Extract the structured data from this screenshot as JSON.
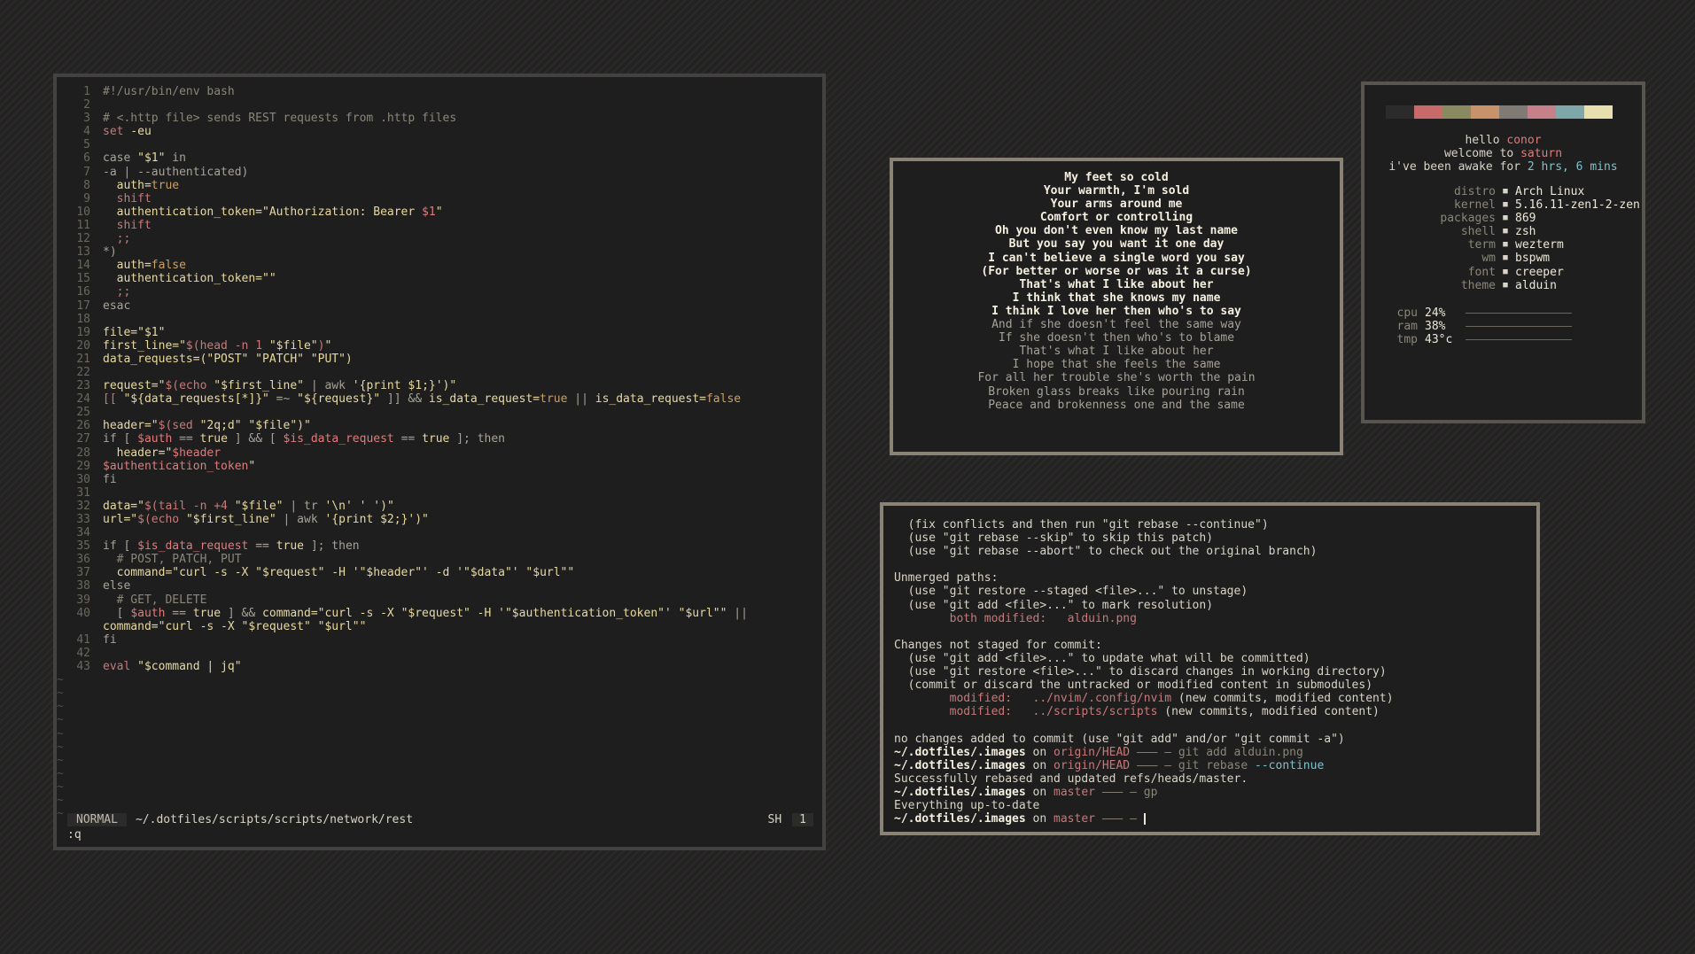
{
  "editor": {
    "lines": [
      {
        "n": "1",
        "segs": [
          {
            "t": "#!/usr/bin/env bash",
            "c": "c-com"
          }
        ]
      },
      {
        "n": "2",
        "segs": []
      },
      {
        "n": "3",
        "segs": [
          {
            "t": "# <.http file> sends REST requests from .http files",
            "c": "c-com"
          }
        ]
      },
      {
        "n": "4",
        "segs": [
          {
            "t": "set",
            "c": "c-fn"
          },
          {
            "t": " -eu",
            "c": "c-str"
          }
        ]
      },
      {
        "n": "5",
        "segs": []
      },
      {
        "n": "6",
        "segs": [
          {
            "t": "case ",
            "c": "c-kw"
          },
          {
            "t": "\"$1\"",
            "c": "c-str"
          },
          {
            "t": " in",
            "c": "c-kw"
          }
        ]
      },
      {
        "n": "7",
        "segs": [
          {
            "t": "-a | --authenticated)",
            "c": "c-kw"
          }
        ]
      },
      {
        "n": "8",
        "segs": [
          {
            "t": "  auth=",
            "c": "c-str"
          },
          {
            "t": "true",
            "c": "c-bool"
          }
        ]
      },
      {
        "n": "9",
        "segs": [
          {
            "t": "  shift",
            "c": "c-fn"
          }
        ]
      },
      {
        "n": "10",
        "segs": [
          {
            "t": "  authentication_token=\"Authorization: Bearer ",
            "c": "c-str"
          },
          {
            "t": "$1",
            "c": "c-var"
          },
          {
            "t": "\"",
            "c": "c-str"
          }
        ]
      },
      {
        "n": "11",
        "segs": [
          {
            "t": "  shift",
            "c": "c-fn"
          }
        ]
      },
      {
        "n": "12",
        "segs": [
          {
            "t": "  ;;",
            "c": "c-fn"
          }
        ]
      },
      {
        "n": "13",
        "segs": [
          {
            "t": "*)",
            "c": "c-kw"
          }
        ]
      },
      {
        "n": "14",
        "segs": [
          {
            "t": "  auth=",
            "c": "c-str"
          },
          {
            "t": "false",
            "c": "c-bool"
          }
        ]
      },
      {
        "n": "15",
        "segs": [
          {
            "t": "  authentication_token=\"\"",
            "c": "c-str"
          }
        ]
      },
      {
        "n": "16",
        "segs": [
          {
            "t": "  ;;",
            "c": "c-fn"
          }
        ]
      },
      {
        "n": "17",
        "segs": [
          {
            "t": "esac",
            "c": "c-kw"
          }
        ]
      },
      {
        "n": "18",
        "segs": []
      },
      {
        "n": "19",
        "segs": [
          {
            "t": "file=\"$1\"",
            "c": "c-str"
          }
        ]
      },
      {
        "n": "20",
        "segs": [
          {
            "t": "first_line=\"",
            "c": "c-str"
          },
          {
            "t": "$(head -n 1 ",
            "c": "c-fn"
          },
          {
            "t": "\"$file\"",
            "c": "c-str"
          },
          {
            "t": ")",
            "c": "c-fn"
          },
          {
            "t": "\"",
            "c": "c-str"
          }
        ]
      },
      {
        "n": "21",
        "segs": [
          {
            "t": "data_requests=(\"POST\" \"PATCH\" \"PUT\")",
            "c": "c-str"
          }
        ]
      },
      {
        "n": "22",
        "segs": []
      },
      {
        "n": "23",
        "segs": [
          {
            "t": "request=\"",
            "c": "c-str"
          },
          {
            "t": "$(echo ",
            "c": "c-fn"
          },
          {
            "t": "\"$first_line\"",
            "c": "c-str"
          },
          {
            "t": " | awk ",
            "c": "c-kw"
          },
          {
            "t": "'{print $1;}'",
            "c": "c-str"
          },
          {
            "t": ")\"",
            "c": "c-str"
          }
        ]
      },
      {
        "n": "24",
        "segs": [
          {
            "t": "[[ ",
            "c": "c-fn"
          },
          {
            "t": "\"${data_requests[*]}\"",
            "c": "c-str"
          },
          {
            "t": " =~ ",
            "c": "c-kw"
          },
          {
            "t": "\"${request}\"",
            "c": "c-str"
          },
          {
            "t": " ]] && ",
            "c": "c-kw"
          },
          {
            "t": "is_data_request=",
            "c": "c-str"
          },
          {
            "t": "true",
            "c": "c-bool"
          },
          {
            "t": " || ",
            "c": "c-kw"
          },
          {
            "t": "is_data_request=",
            "c": "c-str"
          },
          {
            "t": "false",
            "c": "c-bool"
          }
        ]
      },
      {
        "n": "25",
        "segs": []
      },
      {
        "n": "26",
        "segs": [
          {
            "t": "header=\"",
            "c": "c-str"
          },
          {
            "t": "$(sed ",
            "c": "c-fn"
          },
          {
            "t": "\"2q;d\" \"$file\"",
            "c": "c-str"
          },
          {
            "t": ")\"",
            "c": "c-str"
          }
        ]
      },
      {
        "n": "27",
        "segs": [
          {
            "t": "if [ ",
            "c": "c-kw"
          },
          {
            "t": "$auth",
            "c": "c-var"
          },
          {
            "t": " == ",
            "c": "c-kw"
          },
          {
            "t": "true",
            "c": "c-str"
          },
          {
            "t": " ] && [ ",
            "c": "c-kw"
          },
          {
            "t": "$is_data_request",
            "c": "c-var"
          },
          {
            "t": " == ",
            "c": "c-kw"
          },
          {
            "t": "true",
            "c": "c-str"
          },
          {
            "t": " ]; then",
            "c": "c-kw"
          }
        ]
      },
      {
        "n": "28",
        "segs": [
          {
            "t": "  header=\"",
            "c": "c-str"
          },
          {
            "t": "$header",
            "c": "c-var"
          }
        ]
      },
      {
        "n": "29",
        "segs": [
          {
            "t": "$authentication_token",
            "c": "c-var"
          },
          {
            "t": "\"",
            "c": "c-str"
          }
        ]
      },
      {
        "n": "30",
        "segs": [
          {
            "t": "fi",
            "c": "c-kw"
          }
        ]
      },
      {
        "n": "31",
        "segs": []
      },
      {
        "n": "32",
        "segs": [
          {
            "t": "data=\"",
            "c": "c-str"
          },
          {
            "t": "$(tail -n +4 ",
            "c": "c-fn"
          },
          {
            "t": "\"$file\"",
            "c": "c-str"
          },
          {
            "t": " | tr ",
            "c": "c-kw"
          },
          {
            "t": "'\\n' ' ')",
            "c": "c-str"
          },
          {
            "t": "\"",
            "c": "c-str"
          }
        ]
      },
      {
        "n": "33",
        "segs": [
          {
            "t": "url=\"",
            "c": "c-str"
          },
          {
            "t": "$(echo ",
            "c": "c-fn"
          },
          {
            "t": "\"$first_line\"",
            "c": "c-str"
          },
          {
            "t": " | awk ",
            "c": "c-kw"
          },
          {
            "t": "'{print $2;}'",
            "c": "c-str"
          },
          {
            "t": ")\"",
            "c": "c-str"
          }
        ]
      },
      {
        "n": "34",
        "segs": []
      },
      {
        "n": "35",
        "segs": [
          {
            "t": "if [ ",
            "c": "c-kw"
          },
          {
            "t": "$is_data_request",
            "c": "c-var"
          },
          {
            "t": " == ",
            "c": "c-kw"
          },
          {
            "t": "true",
            "c": "c-str"
          },
          {
            "t": " ]; then",
            "c": "c-kw"
          }
        ]
      },
      {
        "n": "36",
        "segs": [
          {
            "t": "  # POST, PATCH, PUT",
            "c": "c-com"
          }
        ]
      },
      {
        "n": "37",
        "segs": [
          {
            "t": "  command=\"curl -s -X \"$request\" -H '\"$header\"' -d '\"$data\"' \"$url\"\"",
            "c": "c-str"
          }
        ]
      },
      {
        "n": "38",
        "segs": [
          {
            "t": "else",
            "c": "c-kw"
          }
        ]
      },
      {
        "n": "39",
        "segs": [
          {
            "t": "  # GET, DELETE",
            "c": "c-com"
          }
        ]
      },
      {
        "n": "40",
        "segs": [
          {
            "t": "  [ ",
            "c": "c-kw"
          },
          {
            "t": "$auth",
            "c": "c-var"
          },
          {
            "t": " == ",
            "c": "c-kw"
          },
          {
            "t": "true",
            "c": "c-str"
          },
          {
            "t": " ] && ",
            "c": "c-kw"
          },
          {
            "t": "command=\"curl -s -X \"$request\" -H '\"$authentication_token\"' \"$url\"\"",
            "c": "c-str"
          },
          {
            "t": " ||",
            "c": "c-kw"
          }
        ]
      },
      {
        "n": "",
        "segs": [
          {
            "t": "command=\"curl -s -X \"$request\" \"$url\"\"",
            "c": "c-str"
          }
        ]
      },
      {
        "n": "41",
        "segs": [
          {
            "t": "fi",
            "c": "c-kw"
          }
        ]
      },
      {
        "n": "42",
        "segs": []
      },
      {
        "n": "43",
        "segs": [
          {
            "t": "eval",
            "c": "c-fn"
          },
          {
            "t": " \"$command | jq\"",
            "c": "c-str"
          }
        ]
      }
    ],
    "tilde_count": 11,
    "tilde": "~",
    "status": {
      "mode": "NORMAL",
      "path": "~/.dotfiles/scripts/scripts/network/rest",
      "filetype": "SH",
      "count": "1"
    },
    "cmdline": ":q"
  },
  "lyrics": {
    "bright": [
      "My feet so cold",
      "Your warmth, I'm sold",
      "Your arms around me",
      "Comfort or controlling",
      "Oh you don't even know my last name",
      "But you say you want it one day",
      "I can't believe a single word you say",
      "(For better or worse or was it a curse)",
      "That's what I like about her",
      "I think that she knows my name",
      "I think I love her then who's to say"
    ],
    "dim": [
      "And if she doesn't feel the same way",
      "If she doesn't then who's to blame",
      "That's what I like about her",
      "I hope that she feels the same",
      "For all her trouble she's worth the pain",
      "Broken glass breaks like pouring rain",
      "Peace and brokenness one and the same"
    ]
  },
  "fetch": {
    "palette": [
      "#2b2b2b",
      "#c96a6a",
      "#8a8a60",
      "#c8936a",
      "#807a74",
      "#c6808a",
      "#7ea7aa",
      "#e8dfae"
    ],
    "hello": "hello ",
    "user": "conor",
    "welcome": "welcome to ",
    "host": "saturn",
    "awake": "i've been awake for ",
    "uptime": "2 hrs, 6 mins",
    "info": [
      {
        "k": "distro",
        "v": "Arch Linux"
      },
      {
        "k": "kernel",
        "v": "5.16.11-zen1-2-zen"
      },
      {
        "k": "packages",
        "v": "869"
      },
      {
        "k": "shell",
        "v": "zsh"
      },
      {
        "k": "term",
        "v": "wezterm"
      },
      {
        "k": "wm",
        "v": "bspwm"
      },
      {
        "k": "font",
        "v": "creeper"
      },
      {
        "k": "theme",
        "v": "alduin"
      }
    ],
    "stats": [
      {
        "k": "cpu",
        "v": "24%"
      },
      {
        "k": "ram",
        "v": "38%"
      },
      {
        "k": "tmp",
        "v": "43°c"
      }
    ]
  },
  "terminal": {
    "lines": [
      [
        {
          "t": "  (fix conflicts and then run \"git rebase --continue\")"
        }
      ],
      [
        {
          "t": "  (use \"git rebase --skip\" to skip this patch)"
        }
      ],
      [
        {
          "t": "  (use \"git rebase --abort\" to check out the original branch)"
        }
      ],
      [
        {
          "t": ""
        }
      ],
      [
        {
          "t": "Unmerged paths:"
        }
      ],
      [
        {
          "t": "  (use \"git restore --staged <file>...\" to unstage)"
        }
      ],
      [
        {
          "t": "  (use \"git add <file>...\" to mark resolution)"
        }
      ],
      [
        {
          "t": "        both modified:   alduin.png",
          "c": "t-red"
        }
      ],
      [
        {
          "t": ""
        }
      ],
      [
        {
          "t": "Changes not staged for commit:"
        }
      ],
      [
        {
          "t": "  (use \"git add <file>...\" to update what will be committed)"
        }
      ],
      [
        {
          "t": "  (use \"git restore <file>...\" to discard changes in working directory)"
        }
      ],
      [
        {
          "t": "  (commit or discard the untracked or modified content in submodules)"
        }
      ],
      [
        {
          "t": "        modified:   ../nvim/.config/nvim ",
          "c": "t-red"
        },
        {
          "t": "(new commits, modified content)"
        }
      ],
      [
        {
          "t": "        modified:   ../scripts/scripts ",
          "c": "t-red"
        },
        {
          "t": "(new commits, modified content)"
        }
      ],
      [
        {
          "t": ""
        }
      ],
      [
        {
          "t": "no changes added to commit (use \"git add\" and/or \"git commit -a\")"
        }
      ],
      [
        {
          "t": "~/.dotfiles/.images",
          "c": "t-pr"
        },
        {
          "t": " on "
        },
        {
          "t": "origin/HEAD",
          "c": "t-red"
        },
        {
          "t": " ——— – ",
          "c": "t-dim"
        },
        {
          "t": "git add alduin.png",
          "c": "t-dim"
        }
      ],
      [
        {
          "t": "~/.dotfiles/.images",
          "c": "t-pr"
        },
        {
          "t": " on "
        },
        {
          "t": "origin/HEAD",
          "c": "t-red"
        },
        {
          "t": " ——— – ",
          "c": "t-dim"
        },
        {
          "t": "git rebase ",
          "c": "t-dim"
        },
        {
          "t": "--continue",
          "c": "t-blue"
        }
      ],
      [
        {
          "t": "Successfully rebased and updated refs/heads/master."
        }
      ],
      [
        {
          "t": "~/.dotfiles/.images",
          "c": "t-pr"
        },
        {
          "t": " on "
        },
        {
          "t": "master",
          "c": "t-red"
        },
        {
          "t": " ——— – ",
          "c": "t-dim"
        },
        {
          "t": "gp",
          "c": "t-dim"
        }
      ],
      [
        {
          "t": "Everything up-to-date"
        }
      ],
      [
        {
          "t": "~/.dotfiles/.images",
          "c": "t-pr"
        },
        {
          "t": " on "
        },
        {
          "t": "master",
          "c": "t-red"
        },
        {
          "t": " ——— – ",
          "c": "t-dim"
        }
      ]
    ]
  }
}
